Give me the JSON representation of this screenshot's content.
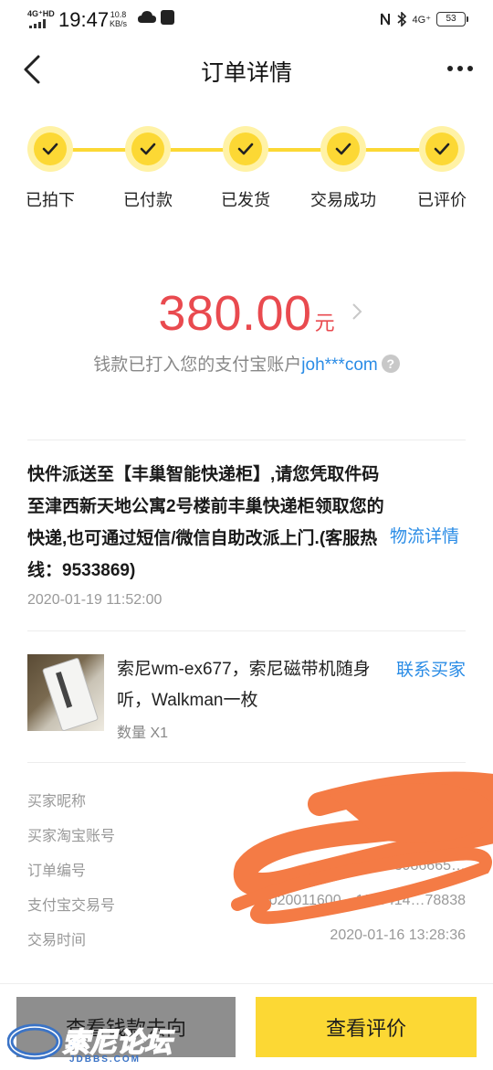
{
  "status_bar": {
    "network": "4G⁺HD",
    "time": "19:47",
    "speed_value": "10.8",
    "speed_unit": "KB/s",
    "cellular": "4G⁺",
    "battery": "53"
  },
  "header": {
    "title": "订单详情"
  },
  "steps": [
    {
      "label": "已拍下",
      "done": true
    },
    {
      "label": "已付款",
      "done": true
    },
    {
      "label": "已发货",
      "done": true
    },
    {
      "label": "交易成功",
      "done": true
    },
    {
      "label": "已评价",
      "done": true
    }
  ],
  "amount": {
    "value": "380.00",
    "unit": "元",
    "account_text": "钱款已打入您的支付宝账户",
    "account": "joh***com",
    "help_glyph": "?"
  },
  "logistics": {
    "text": "快件派送至【丰巢智能快递柜】,请您凭取件码至津西新天地公寓2号楼前丰巢快递柜领取您的快递,也可通过短信/微信自助改派上门.(客服热线：9533869)",
    "link": "物流详情",
    "time": "2020-01-19 11:52:00"
  },
  "product": {
    "title": "索尼wm-ex677，索尼磁带机随身听，Walkman一枚",
    "quantity": "数量 X1",
    "contact": "联系买家"
  },
  "info_rows": [
    {
      "label": "买家昵称",
      "value": ""
    },
    {
      "label": "买家淘宝账号",
      "value": ""
    },
    {
      "label": "订单编号",
      "value": "…2073986665…"
    },
    {
      "label": "支付宝交易号",
      "value": "2020011600…1118414…78838"
    },
    {
      "label": "交易时间",
      "value": "2020-01-16 13:28:36"
    }
  ],
  "buttons": {
    "money_flow": "查看钱款去向",
    "view_review": "查看评价"
  },
  "watermark": {
    "text": "索尼论坛",
    "sub": "JDBBS.COM"
  },
  "colors": {
    "accent_yellow": "#fcd834",
    "amount_red": "#e94a4f",
    "link_blue": "#2a8ce6",
    "scribble": "#f47b45"
  }
}
